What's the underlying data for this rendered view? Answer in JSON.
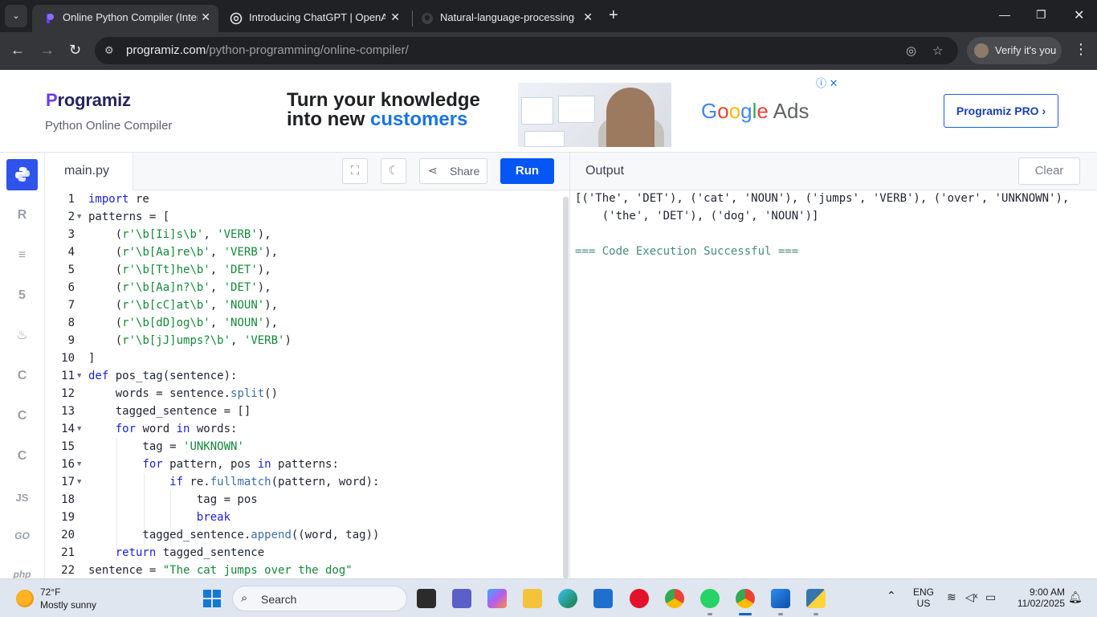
{
  "browser": {
    "tabs": [
      {
        "title": "Online Python Compiler (Interpreter)",
        "active": true
      },
      {
        "title": "Introducing ChatGPT | OpenAI",
        "active": false
      },
      {
        "title": "Natural-language-processing-/",
        "active": false
      }
    ],
    "url_host": "programiz.com",
    "url_path": "/python-programming/online-compiler/",
    "verify_label": "Verify it's you"
  },
  "header": {
    "logo_initial": "P",
    "logo_rest": "rogramiz",
    "subtitle": "Python Online Compiler",
    "ad_line1": "Turn your knowledge",
    "ad_line2_prefix": "into new ",
    "ad_line2_accent": "customers",
    "ad_brand_g": "G",
    "ad_brand_o1": "o",
    "ad_brand_o2": "o",
    "ad_brand_g2": "g",
    "ad_brand_l": "l",
    "ad_brand_e": "e",
    "ad_brand_ads": " Ads",
    "adchoices": "ⓘ ✕",
    "pro_button": "Programiz PRO ›"
  },
  "sidebar": {
    "items": [
      {
        "label": "Py",
        "name": "python"
      },
      {
        "label": "R",
        "name": "r"
      },
      {
        "label": "≡",
        "name": "sql"
      },
      {
        "label": "5",
        "name": "html"
      },
      {
        "label": "♨",
        "name": "java"
      },
      {
        "label": "C",
        "name": "c"
      },
      {
        "label": "C",
        "name": "cpp"
      },
      {
        "label": "C",
        "name": "csharp"
      },
      {
        "label": "JS",
        "name": "javascript"
      },
      {
        "label": "GO",
        "name": "go"
      },
      {
        "label": "php",
        "name": "php"
      }
    ]
  },
  "editor": {
    "filename": "main.py",
    "share_label": "Share",
    "run_label": "Run",
    "lines": [
      {
        "n": "1",
        "code": "import re"
      },
      {
        "n": "2",
        "code": "patterns = ["
      },
      {
        "n": "3",
        "code": "    (r'\\b[Ii]s\\b', 'VERB'),"
      },
      {
        "n": "4",
        "code": "    (r'\\b[Aa]re\\b', 'VERB'),"
      },
      {
        "n": "5",
        "code": "    (r'\\b[Tt]he\\b', 'DET'),"
      },
      {
        "n": "6",
        "code": "    (r'\\b[Aa]n?\\b', 'DET'),"
      },
      {
        "n": "7",
        "code": "    (r'\\b[cC]at\\b', 'NOUN'),"
      },
      {
        "n": "8",
        "code": "    (r'\\b[dD]og\\b', 'NOUN'),"
      },
      {
        "n": "9",
        "code": "    (r'\\b[jJ]umps?\\b', 'VERB')"
      },
      {
        "n": "10",
        "code": "]"
      },
      {
        "n": "11",
        "code": "def pos_tag(sentence):"
      },
      {
        "n": "12",
        "code": "    words = sentence.split()"
      },
      {
        "n": "13",
        "code": "    tagged_sentence = []"
      },
      {
        "n": "14",
        "code": "    for word in words:"
      },
      {
        "n": "15",
        "code": "        tag = 'UNKNOWN'"
      },
      {
        "n": "16",
        "code": "        for pattern, pos in patterns:"
      },
      {
        "n": "17",
        "code": "            if re.fullmatch(pattern, word):"
      },
      {
        "n": "18",
        "code": "                tag = pos"
      },
      {
        "n": "19",
        "code": "                break"
      },
      {
        "n": "20",
        "code": "        tagged_sentence.append((word, tag))"
      },
      {
        "n": "21",
        "code": "    return tagged_sentence"
      },
      {
        "n": "22",
        "code": "sentence = \"The cat jumps over the dog\""
      }
    ]
  },
  "output": {
    "title": "Output",
    "clear_label": "Clear",
    "line1": "[('The', 'DET'), ('cat', 'NOUN'), ('jumps', 'VERB'), ('over', 'UNKNOWN'),",
    "line2": "    ('the', 'DET'), ('dog', 'NOUN')]",
    "status": "=== Code Execution Successful ==="
  },
  "taskbar": {
    "temp": "72°F",
    "weather": "Mostly sunny",
    "search_label": "Search",
    "lang1": "ENG",
    "lang2": "US",
    "time": "9:00 AM",
    "date": "11/02/2025"
  },
  "colors": {
    "accent": "#0556f3",
    "rail_active": "#2f54eb",
    "keyword": "#1b1fd6",
    "string": "#14883a",
    "success": "#4b8d7a"
  }
}
